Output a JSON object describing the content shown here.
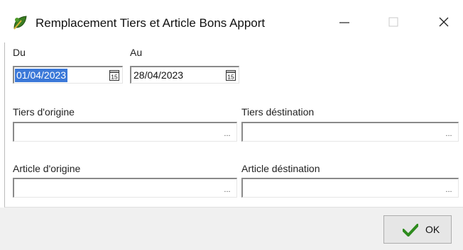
{
  "window": {
    "title": "Remplacement Tiers et Article Bons Apport",
    "app_icon": "leaf-icon"
  },
  "dates": {
    "from_label": "Du",
    "from_value": "01/04/2023",
    "to_label": "Au",
    "to_value": "28/04/2023",
    "calendar_icon": "calendar-icon",
    "calendar_text": "15"
  },
  "fields": {
    "tiers_origin_label": "Tiers d'origine",
    "tiers_origin_value": "",
    "tiers_dest_label": "Tiers déstination",
    "tiers_dest_value": "",
    "article_origin_label": "Article d'origine",
    "article_origin_value": "",
    "article_dest_label": "Article déstination",
    "article_dest_value": "",
    "browse_label": "..."
  },
  "footer": {
    "ok_label": "OK",
    "ok_icon": "checkmark-icon",
    "accent": "#2e8b1e"
  }
}
